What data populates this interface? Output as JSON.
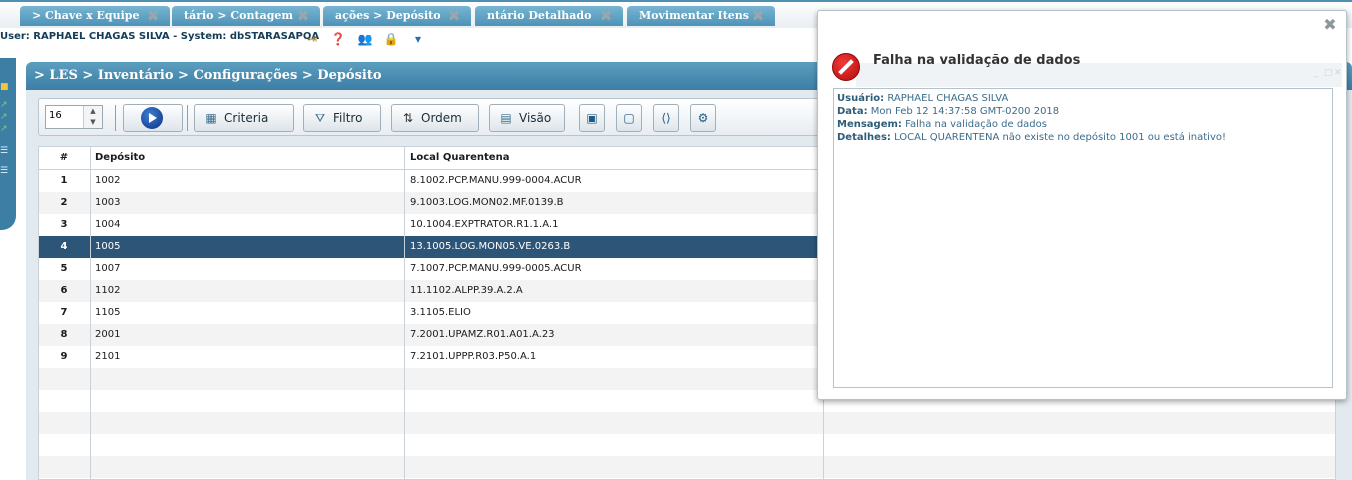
{
  "tabs": [
    {
      "label": "> Chave x Equipe"
    },
    {
      "label": "tário > Contagem"
    },
    {
      "label": "ações > Depósito"
    },
    {
      "label": "ntário Detalhado"
    },
    {
      "label": "Movimentar Itens"
    }
  ],
  "userbar": {
    "text": "User: RAPHAEL CHAGAS SILVA - System: dbSTARASAPQA"
  },
  "panel": {
    "breadcrumb": "> LES > Inventário > Configurações > Depósito"
  },
  "toolbar": {
    "page_size": "16",
    "criteria_label": "Criteria",
    "filtro_label": "Filtro",
    "ordem_label": "Ordem",
    "visao_label": "Visão"
  },
  "grid": {
    "columns": [
      "#",
      "Depósito",
      "Local Quarentena"
    ],
    "rows": [
      {
        "num": "1",
        "deposito": "1002",
        "local": "8.1002.PCP.MANU.999-0004.ACUR"
      },
      {
        "num": "2",
        "deposito": "1003",
        "local": "9.1003.LOG.MON02.MF.0139.B"
      },
      {
        "num": "3",
        "deposito": "1004",
        "local": "10.1004.EXPTRATOR.R1.1.A.1"
      },
      {
        "num": "4",
        "deposito": "1005",
        "local": "13.1005.LOG.MON05.VE.0263.B"
      },
      {
        "num": "5",
        "deposito": "1007",
        "local": "7.1007.PCP.MANU.999-0005.ACUR"
      },
      {
        "num": "6",
        "deposito": "1102",
        "local": "11.1102.ALPP.39.A.2.A"
      },
      {
        "num": "7",
        "deposito": "1105",
        "local": "3.1105.ELIO"
      },
      {
        "num": "8",
        "deposito": "2001",
        "local": "7.2001.UPAMZ.R01.A01.A.23"
      },
      {
        "num": "9",
        "deposito": "2101",
        "local": "7.2101.UPPP.R03.P50.A.1"
      }
    ],
    "selected_row": "4"
  },
  "modal": {
    "title": "Falha na validação de dados",
    "usuario_label": "Usuário:",
    "usuario": "RAPHAEL CHAGAS SILVA",
    "data_label": "Data:",
    "data": "Mon Feb 12 14:37:58 GMT-0200 2018",
    "mensagem_label": "Mensagem:",
    "mensagem": "Falha na validação de dados",
    "detalhes_label": "Detalhes:",
    "detalhes": "LOCAL QUARENTENA não existe no depósito 1001 ou está inativo!"
  },
  "colors": {
    "tab": "#5a9ec1",
    "panel_header": "#3c7ea5",
    "selected_row": "#2c5577",
    "modal_text": "#3b6d8c",
    "error_icon": "#d01515"
  },
  "icons": [
    "close-icon",
    "play-icon",
    "criteria-icon",
    "filter-icon",
    "sort-icon",
    "view-icon",
    "export-icon",
    "save-icon",
    "code-icon",
    "settings-icon",
    "stop-error-icon"
  ]
}
